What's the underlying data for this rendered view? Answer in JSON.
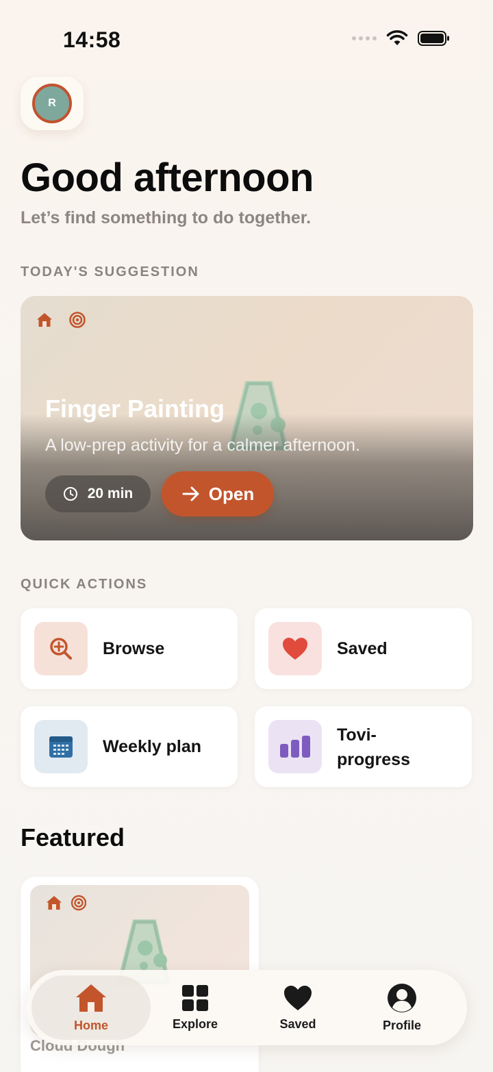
{
  "status_bar": {
    "time": "14:58"
  },
  "user": {
    "initial": "R"
  },
  "greeting": "Good afternoon",
  "subtitle": "Let’s find something to do together.",
  "suggestion": {
    "section_label": "TODAY'S SUGGESTION",
    "title": "Finger Painting",
    "description": "A low-prep activity for a calmer afternoon.",
    "duration": "20 min",
    "open_label": "Open"
  },
  "quick_actions": {
    "section_label": "QUICK ACTIONS",
    "items": [
      {
        "label": "Browse",
        "icon": "search-plus-icon"
      },
      {
        "label": "Saved",
        "icon": "heart-icon"
      },
      {
        "label": "Weekly plan",
        "icon": "calendar-icon"
      },
      {
        "label": "Tovi-progress",
        "icon": "bar-chart-icon"
      }
    ]
  },
  "featured": {
    "title": "Featured",
    "items": [
      {
        "label": "Cloud Dough"
      }
    ]
  },
  "tabbar": {
    "items": [
      {
        "label": "Home",
        "icon": "home-icon",
        "active": true
      },
      {
        "label": "Explore",
        "icon": "grid-icon"
      },
      {
        "label": "Saved",
        "icon": "heart-icon"
      },
      {
        "label": "Profile",
        "icon": "user-circle-icon"
      }
    ]
  },
  "colors": {
    "accent": "#c2552c",
    "avatar_bg": "#7fa89c",
    "browse_tile": "#f6e1d8",
    "saved_tile": "#f8e1df",
    "plan_tile": "#e1eaf1",
    "progress_tile": "#ebe3f4"
  }
}
